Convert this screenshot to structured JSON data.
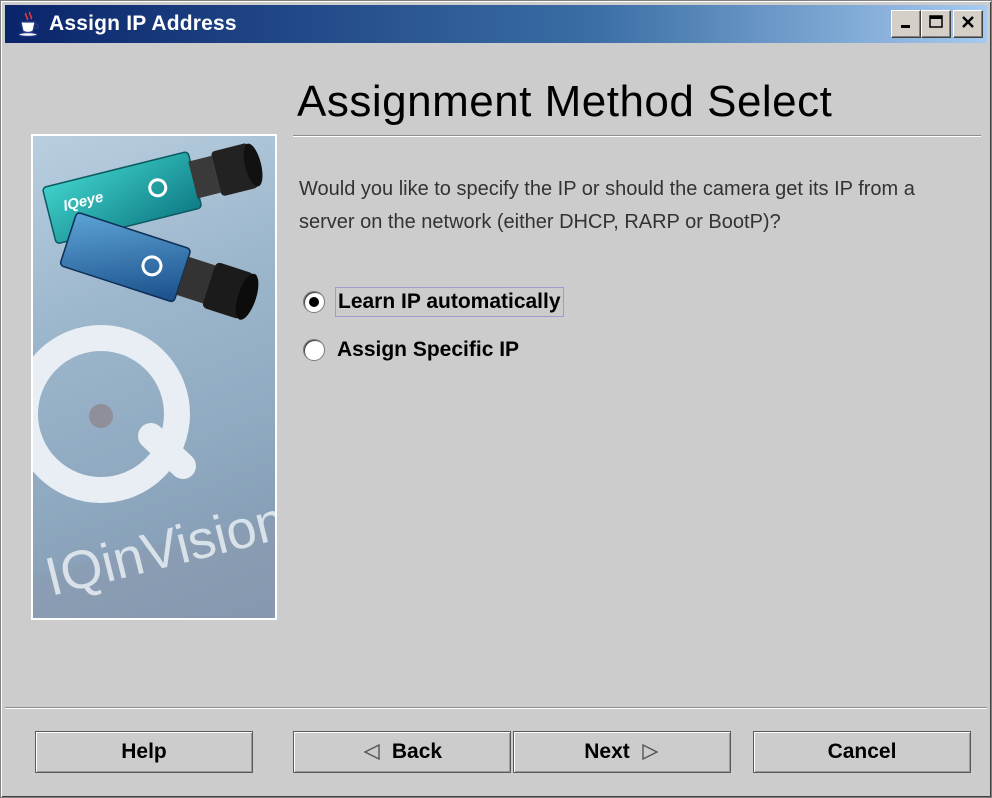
{
  "window": {
    "title": "Assign IP Address"
  },
  "page": {
    "heading": "Assignment Method Select",
    "question": "Would you like to specify the IP or should the camera get its IP from a server on the network (either DHCP, RARP or BootP)?"
  },
  "side_image": {
    "brand_text": "IQinVision",
    "product_text": "IQeye"
  },
  "options": [
    {
      "label": "Learn IP automatically",
      "selected": true
    },
    {
      "label": "Assign Specific IP",
      "selected": false
    }
  ],
  "buttons": {
    "help": "Help",
    "back": "Back",
    "next": "Next",
    "cancel": "Cancel"
  },
  "icons": {
    "app": "java-cup-icon",
    "minimize": "minimize-icon",
    "maximize": "maximize-icon",
    "close": "close-icon",
    "back_arrow": "triangle-left-icon",
    "next_arrow": "triangle-right-icon"
  }
}
